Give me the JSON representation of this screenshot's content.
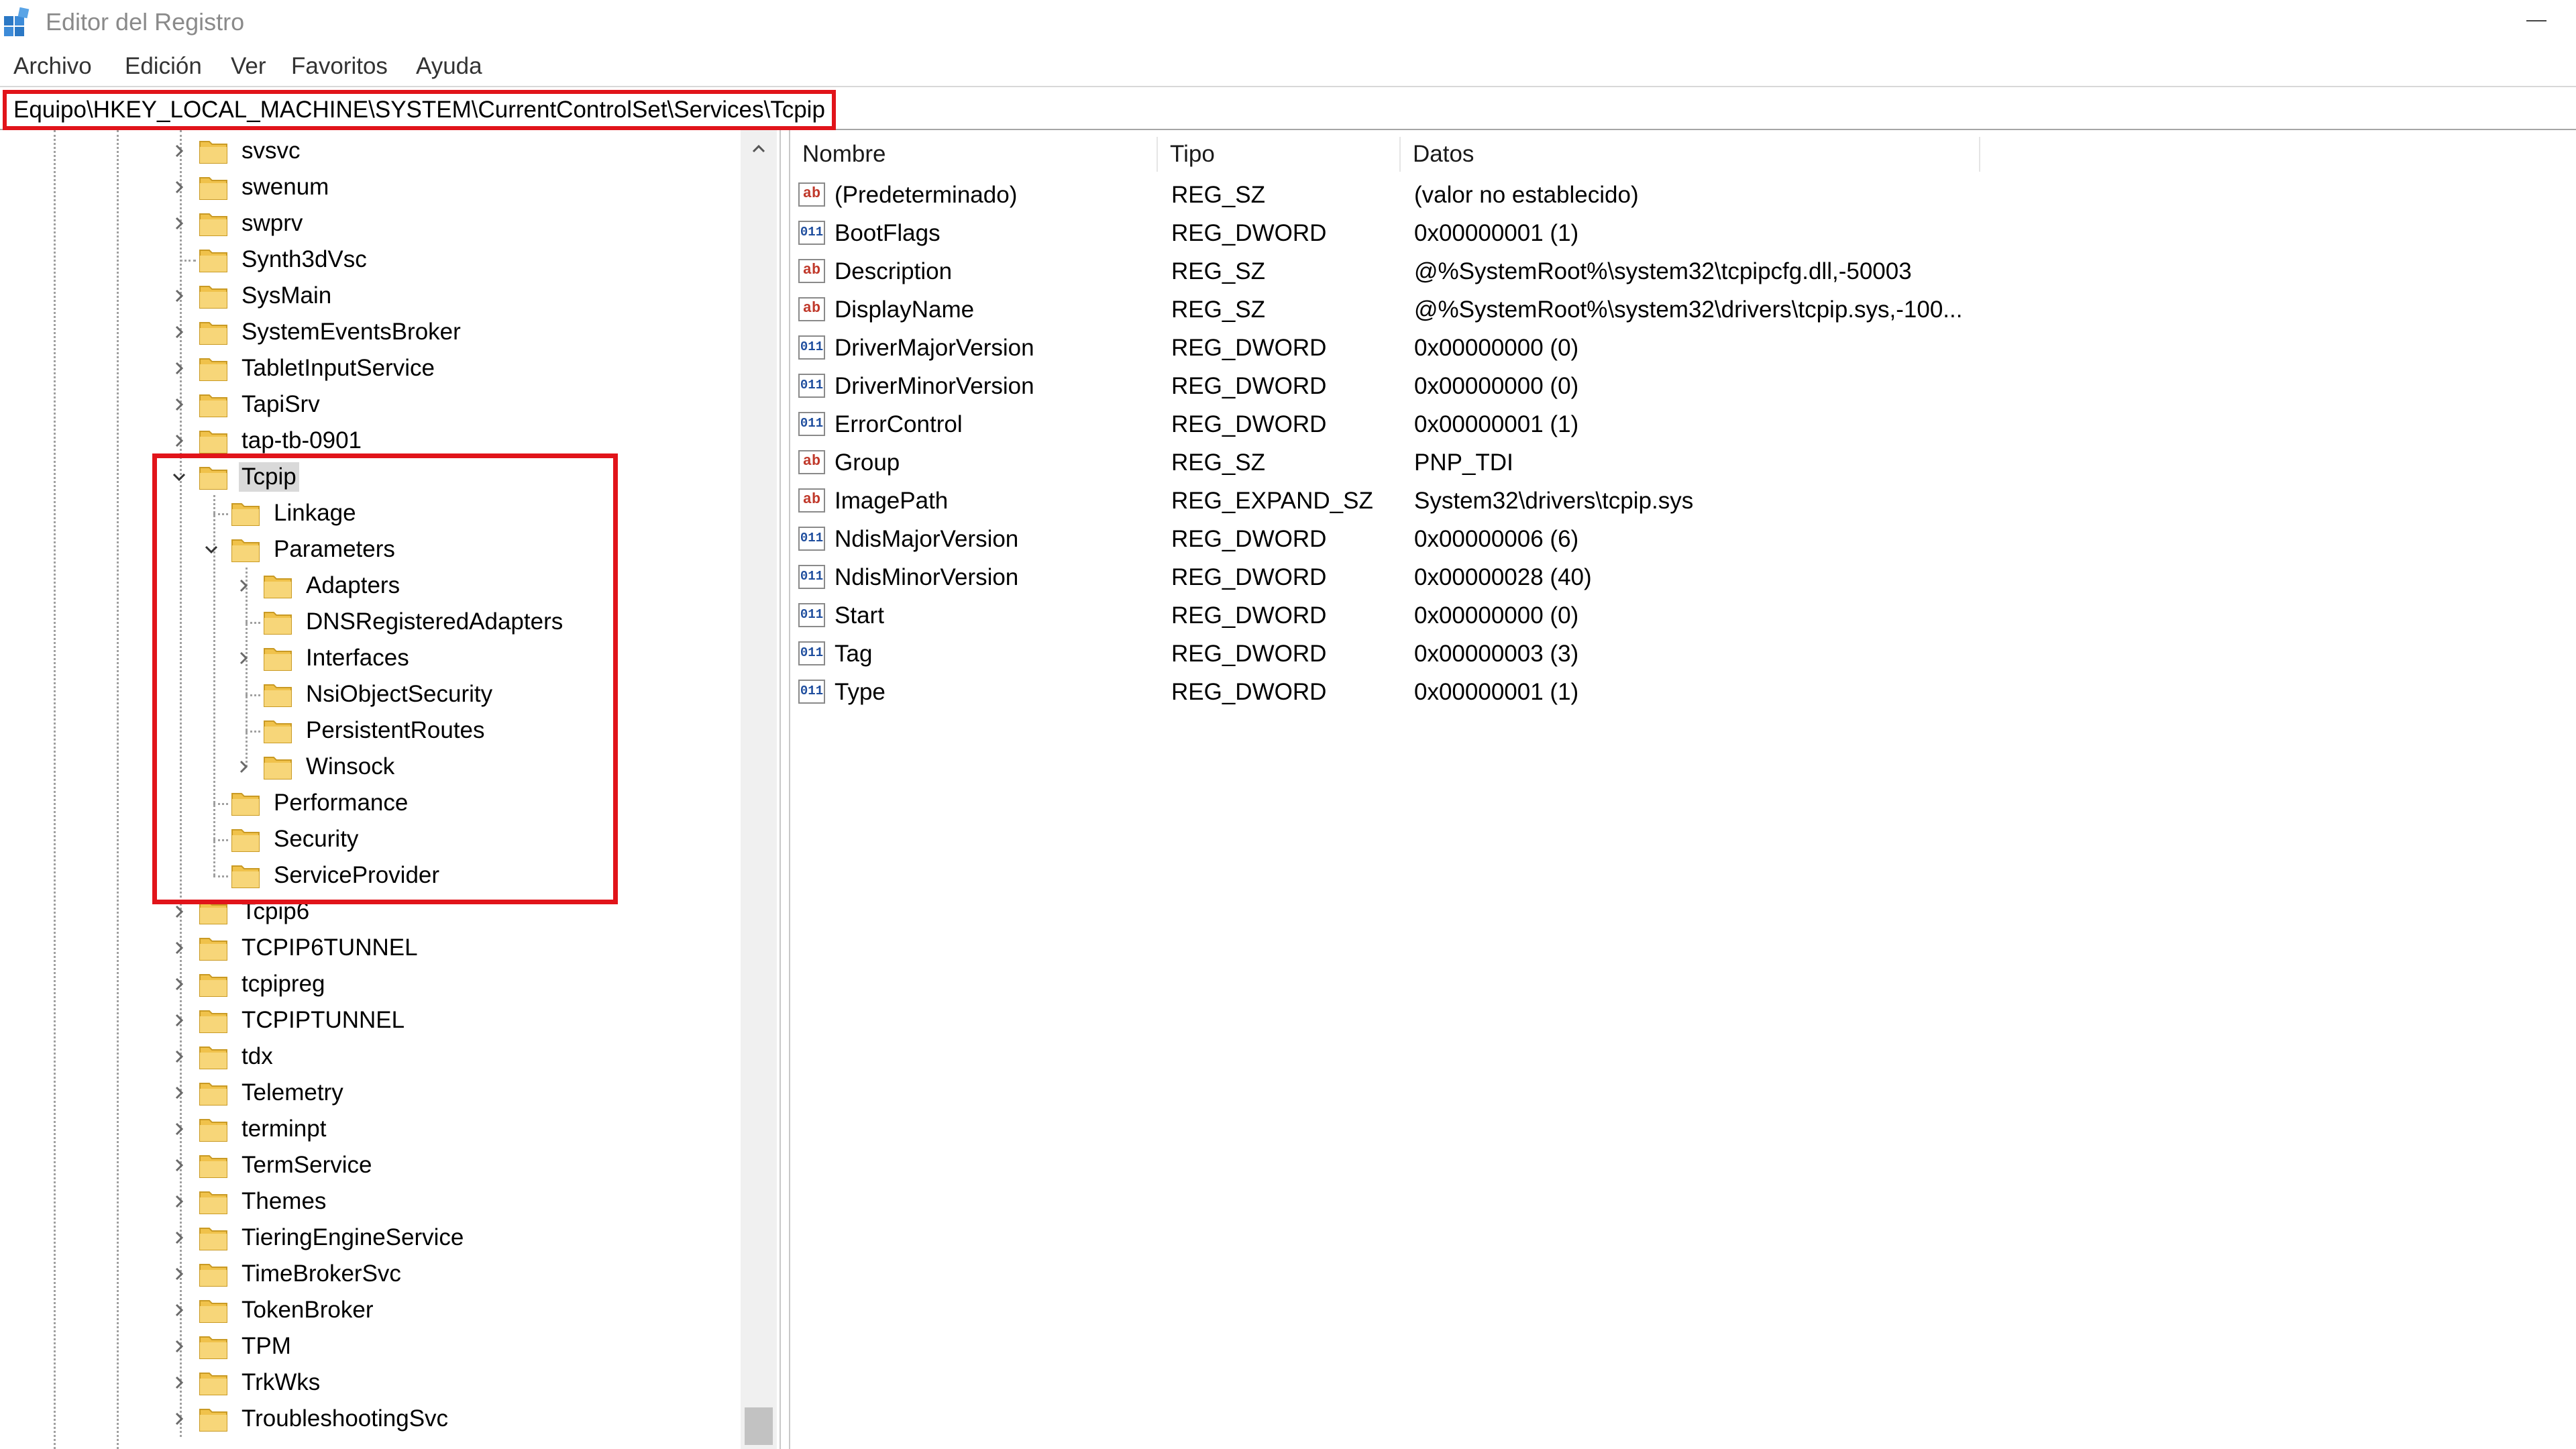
{
  "window": {
    "title": "Editor del Registro"
  },
  "menu": [
    "Archivo",
    "Edición",
    "Ver",
    "Favoritos",
    "Ayuda"
  ],
  "address": {
    "path": "Equipo\\HKEY_LOCAL_MACHINE\\SYSTEM\\CurrentControlSet\\Services\\Tcpip"
  },
  "tree": {
    "items": [
      {
        "label": "svsvc",
        "level": 0,
        "expander": "collapsed"
      },
      {
        "label": "swenum",
        "level": 0,
        "expander": "collapsed"
      },
      {
        "label": "swprv",
        "level": 0,
        "expander": "collapsed"
      },
      {
        "label": "Synth3dVsc",
        "level": 0,
        "expander": "none"
      },
      {
        "label": "SysMain",
        "level": 0,
        "expander": "collapsed"
      },
      {
        "label": "SystemEventsBroker",
        "level": 0,
        "expander": "collapsed"
      },
      {
        "label": "TabletInputService",
        "level": 0,
        "expander": "collapsed"
      },
      {
        "label": "TapiSrv",
        "level": 0,
        "expander": "collapsed"
      },
      {
        "label": "tap-tb-0901",
        "level": 0,
        "expander": "collapsed"
      },
      {
        "label": "Tcpip",
        "level": 0,
        "expander": "expanded",
        "selected": true
      },
      {
        "label": "Linkage",
        "level": 1,
        "expander": "none"
      },
      {
        "label": "Parameters",
        "level": 1,
        "expander": "expanded"
      },
      {
        "label": "Adapters",
        "level": 2,
        "expander": "collapsed"
      },
      {
        "label": "DNSRegisteredAdapters",
        "level": 2,
        "expander": "none"
      },
      {
        "label": "Interfaces",
        "level": 2,
        "expander": "collapsed"
      },
      {
        "label": "NsiObjectSecurity",
        "level": 2,
        "expander": "none"
      },
      {
        "label": "PersistentRoutes",
        "level": 2,
        "expander": "none"
      },
      {
        "label": "Winsock",
        "level": 2,
        "expander": "collapsed"
      },
      {
        "label": "Performance",
        "level": 1,
        "expander": "none"
      },
      {
        "label": "Security",
        "level": 1,
        "expander": "none"
      },
      {
        "label": "ServiceProvider",
        "level": 1,
        "expander": "none"
      },
      {
        "label": "Tcpip6",
        "level": 0,
        "expander": "collapsed"
      },
      {
        "label": "TCPIP6TUNNEL",
        "level": 0,
        "expander": "collapsed"
      },
      {
        "label": "tcpipreg",
        "level": 0,
        "expander": "collapsed"
      },
      {
        "label": "TCPIPTUNNEL",
        "level": 0,
        "expander": "collapsed"
      },
      {
        "label": "tdx",
        "level": 0,
        "expander": "collapsed"
      },
      {
        "label": "Telemetry",
        "level": 0,
        "expander": "collapsed"
      },
      {
        "label": "terminpt",
        "level": 0,
        "expander": "collapsed"
      },
      {
        "label": "TermService",
        "level": 0,
        "expander": "collapsed"
      },
      {
        "label": "Themes",
        "level": 0,
        "expander": "collapsed"
      },
      {
        "label": "TieringEngineService",
        "level": 0,
        "expander": "collapsed"
      },
      {
        "label": "TimeBrokerSvc",
        "level": 0,
        "expander": "collapsed"
      },
      {
        "label": "TokenBroker",
        "level": 0,
        "expander": "collapsed"
      },
      {
        "label": "TPM",
        "level": 0,
        "expander": "collapsed"
      },
      {
        "label": "TrkWks",
        "level": 0,
        "expander": "collapsed"
      },
      {
        "label": "TroubleshootingSvc",
        "level": 0,
        "expander": "collapsed"
      }
    ]
  },
  "list": {
    "columns": [
      "Nombre",
      "Tipo",
      "Datos"
    ],
    "rows": [
      {
        "icon": "string-value-icon",
        "name": "(Predeterminado)",
        "type": "REG_SZ",
        "data": "(valor no establecido)"
      },
      {
        "icon": "dword-value-icon",
        "name": "BootFlags",
        "type": "REG_DWORD",
        "data": "0x00000001 (1)"
      },
      {
        "icon": "string-value-icon",
        "name": "Description",
        "type": "REG_SZ",
        "data": "@%SystemRoot%\\system32\\tcpipcfg.dll,-50003"
      },
      {
        "icon": "string-value-icon",
        "name": "DisplayName",
        "type": "REG_SZ",
        "data": "@%SystemRoot%\\system32\\drivers\\tcpip.sys,-100..."
      },
      {
        "icon": "dword-value-icon",
        "name": "DriverMajorVersion",
        "type": "REG_DWORD",
        "data": "0x00000000 (0)"
      },
      {
        "icon": "dword-value-icon",
        "name": "DriverMinorVersion",
        "type": "REG_DWORD",
        "data": "0x00000000 (0)"
      },
      {
        "icon": "dword-value-icon",
        "name": "ErrorControl",
        "type": "REG_DWORD",
        "data": "0x00000001 (1)"
      },
      {
        "icon": "string-value-icon",
        "name": "Group",
        "type": "REG_SZ",
        "data": "PNP_TDI"
      },
      {
        "icon": "string-value-icon",
        "name": "ImagePath",
        "type": "REG_EXPAND_SZ",
        "data": "System32\\drivers\\tcpip.sys"
      },
      {
        "icon": "dword-value-icon",
        "name": "NdisMajorVersion",
        "type": "REG_DWORD",
        "data": "0x00000006 (6)"
      },
      {
        "icon": "dword-value-icon",
        "name": "NdisMinorVersion",
        "type": "REG_DWORD",
        "data": "0x00000028 (40)"
      },
      {
        "icon": "dword-value-icon",
        "name": "Start",
        "type": "REG_DWORD",
        "data": "0x00000000 (0)"
      },
      {
        "icon": "dword-value-icon",
        "name": "Tag",
        "type": "REG_DWORD",
        "data": "0x00000003 (3)"
      },
      {
        "icon": "dword-value-icon",
        "name": "Type",
        "type": "REG_DWORD",
        "data": "0x00000001 (1)"
      }
    ]
  },
  "icons": {
    "string": "ab",
    "dword": "011\n110"
  },
  "colors": {
    "highlight": "#e1141a",
    "folder": "#f0c24b",
    "selection": "#d9d9d9"
  }
}
